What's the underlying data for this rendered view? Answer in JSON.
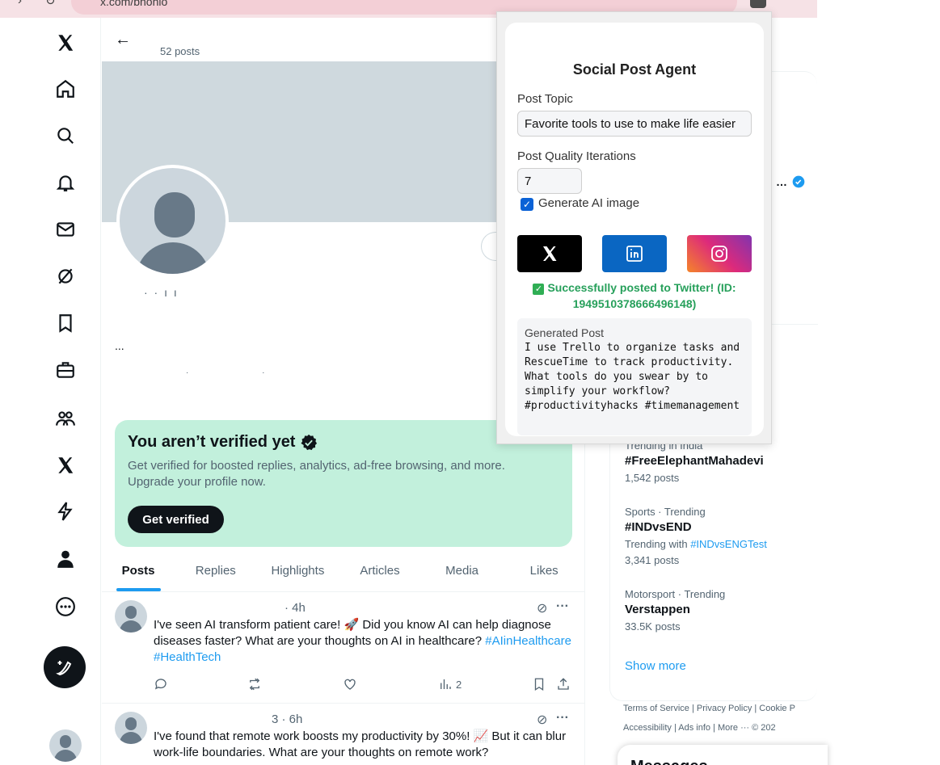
{
  "browser": {
    "address": "x.com/bnohio"
  },
  "profile": {
    "post_count": "52 posts",
    "name_fragment": "· · ı ı",
    "bio_dots": "...",
    "bio_fragment": "· ·"
  },
  "verify_card": {
    "title": "You aren’t verified yet",
    "description": "Get verified for boosted replies, analytics, ad-free browsing, and more. Upgrade your profile now.",
    "button": "Get verified"
  },
  "tabs": [
    "Posts",
    "Replies",
    "Highlights",
    "Articles",
    "Media",
    "Likes"
  ],
  "tweets": [
    {
      "meta": "· 4h",
      "text": "I've seen AI transform patient care! 🚀 Did you know AI can help diagnose diseases faster? What are your thoughts on AI in healthcare?",
      "hashtags": "#AIinHealthcare #HealthTech",
      "views": "2"
    },
    {
      "meta": "3 · 6h",
      "text": "I've found that remote work boosts my productivity by 30%! 📈 But it can blur work-life boundaries. What are your thoughts on remote work?"
    }
  ],
  "trends": [
    {
      "sub": "Trending in India",
      "name": "#FreeElephantMahadevi",
      "count": "1,542 posts"
    },
    {
      "sub": "Sports · Trending",
      "name": "#INDvsEND",
      "trending_with_label": "Trending with",
      "trending_with": "#INDvsENGTest",
      "count": "3,341 posts"
    },
    {
      "sub": "Motorsport · Trending",
      "name": "Verstappen",
      "count": "33.5K posts"
    }
  ],
  "show_more": "Show more",
  "footer": {
    "line1": "Terms of Service  |   Privacy Policy  |   Cookie P",
    "line2": "Accessibility  |   Ads info  |   More ···   © 202"
  },
  "messages": {
    "title": "Messages"
  },
  "popup": {
    "title": "Social Post Agent",
    "topic_label": "Post Topic",
    "topic_value": "Favorite tools to use to make life easier",
    "iterations_label": "Post Quality Iterations",
    "iterations_value": "7",
    "ai_image_label": "Generate AI image",
    "ai_image_checked": true,
    "status": "Successfully posted to Twitter! (ID: 1949510378666496148)",
    "generated_label": "Generated Post",
    "generated_text": "I use Trello to organize tasks and RescueTime to track productivity. What tools do you swear by to simplify your workflow? #productivityhacks #timemanagement"
  },
  "colors": {
    "accent": "#1d9bf0",
    "verify_bg": "#c2f0dc",
    "linkedin": "#0a66c2",
    "success": "#27a05b"
  }
}
